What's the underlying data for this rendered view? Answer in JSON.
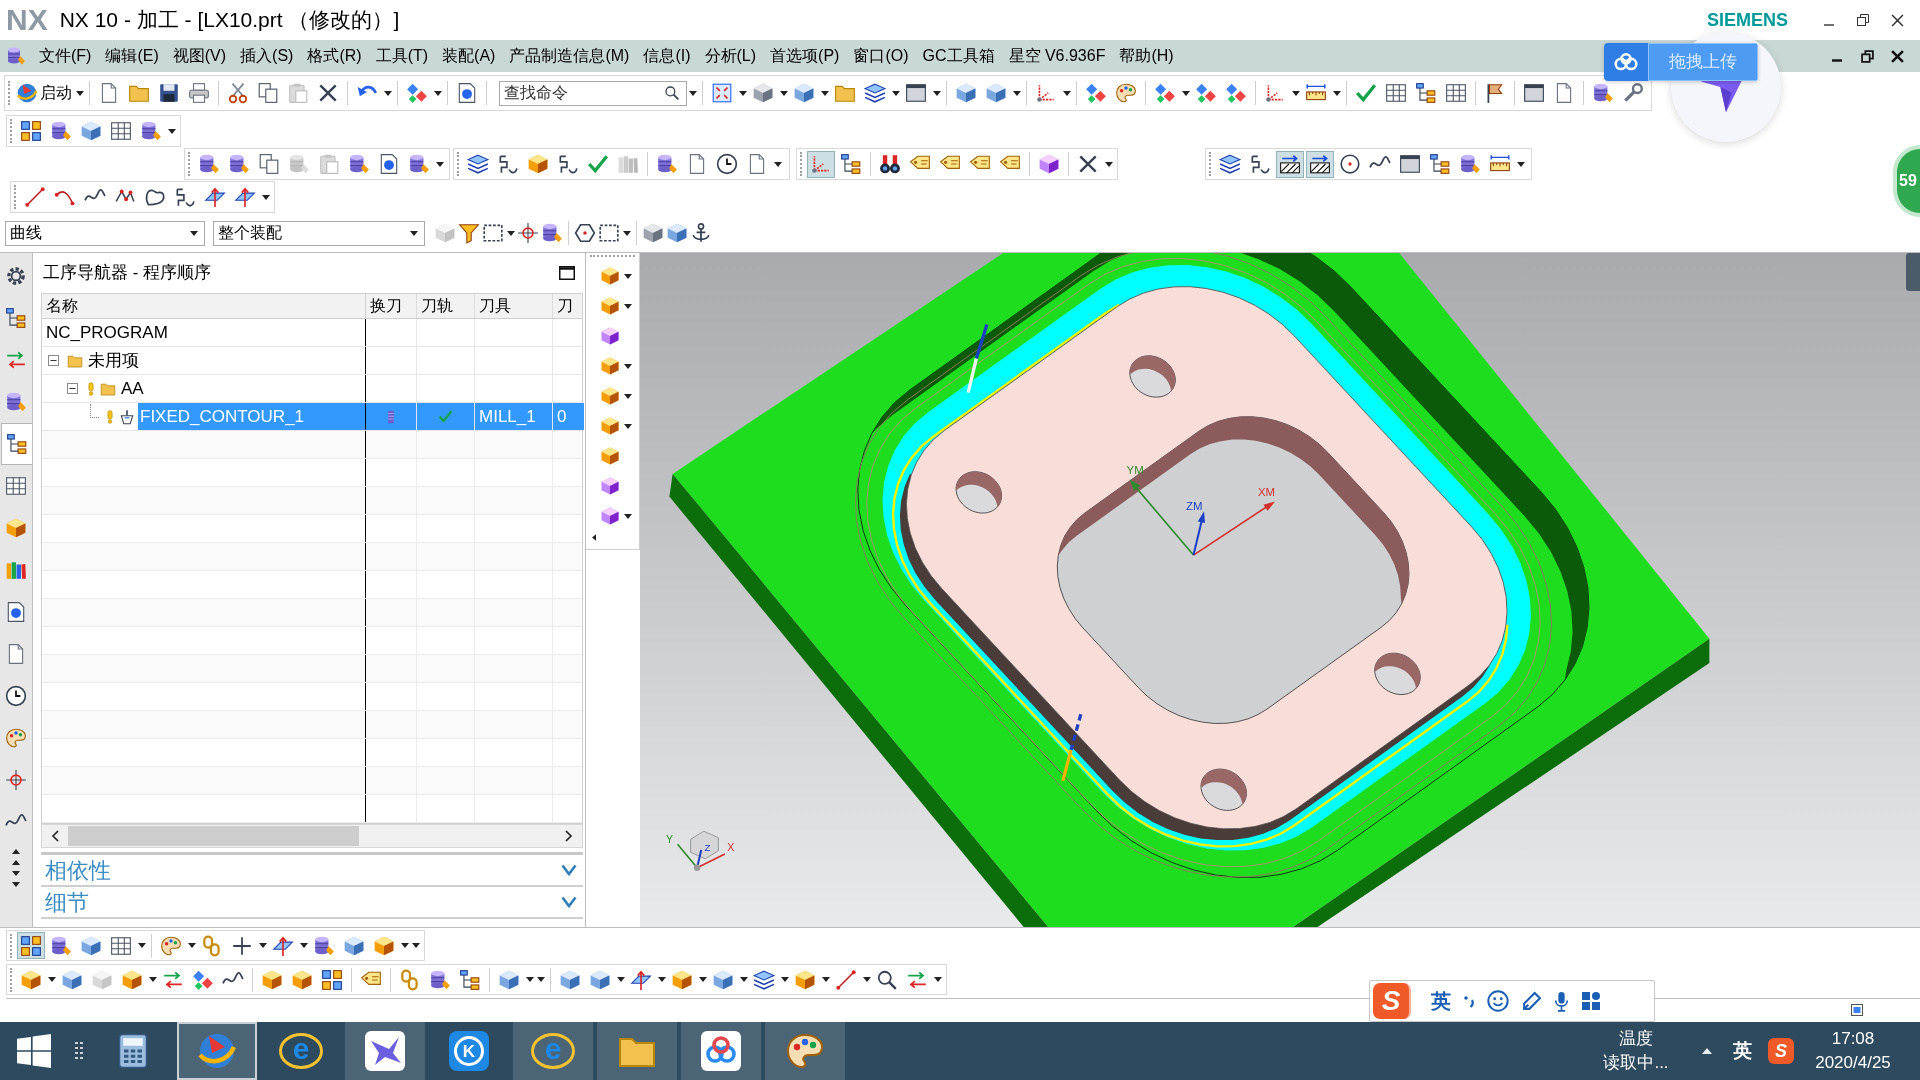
{
  "window": {
    "logo": "NX",
    "title": "NX 10 - 加工 - [LX10.prt （修改的）]",
    "brand": "SIEMENS"
  },
  "menu": [
    "文件(F)",
    "编辑(E)",
    "视图(V)",
    "插入(S)",
    "格式(R)",
    "工具(T)",
    "装配(A)",
    "产品制造信息(M)",
    "信息(I)",
    "分析(L)",
    "首选项(P)",
    "窗口(O)",
    "GC工具箱",
    "星空 V6.936F",
    "帮助(H)"
  ],
  "launch_button": {
    "label": "启动"
  },
  "command_finder": {
    "placeholder": "查找命令"
  },
  "toolbar_states": {
    "edit": [
      {
        "disabled": false
      },
      {
        "disabled": false
      },
      {
        "disabled": true
      },
      {
        "disabled": false
      }
    ],
    "operations": [
      {
        "disabled": false
      },
      {
        "disabled": false
      },
      {
        "disabled": false
      },
      {
        "disabled": true
      },
      {
        "disabled": true
      },
      {
        "disabled": false
      },
      {
        "disabled": false
      },
      {
        "disabled": false
      }
    ],
    "toolpath": [
      {
        "disabled": false
      },
      {
        "disabled": false
      },
      {
        "disabled": false
      },
      {
        "disabled": false
      },
      {
        "disabled": false
      },
      {
        "disabled": true
      },
      {
        "disabled": false
      },
      {
        "disabled": false
      },
      {
        "disabled": false
      },
      {
        "disabled": false
      }
    ],
    "display": [
      {
        "pressed": true
      },
      {
        "pressed": false
      },
      {
        "pressed": false
      },
      {
        "pressed": false
      },
      {
        "pressed": false
      },
      {
        "pressed": false
      },
      {
        "pressed": false
      },
      {
        "pressed": false
      }
    ],
    "analysis": [
      {
        "pressed": false
      },
      {
        "pressed": false
      },
      {
        "pressed": true
      },
      {
        "pressed": true
      },
      {
        "pressed": false
      },
      {
        "pressed": false
      },
      {
        "pressed": false
      },
      {
        "pressed": false
      },
      {
        "pressed": false
      },
      {
        "pressed": false
      }
    ],
    "selection": [
      {
        "disabled": true
      },
      {
        "disabled": false
      },
      {
        "disabled": false
      },
      {
        "disabled": false
      },
      {
        "disabled": false
      },
      {
        "disabled": false
      },
      {
        "disabled": false
      },
      {
        "disabled": false
      },
      {
        "disabled": false
      },
      {
        "disabled": false
      }
    ],
    "assembly": [
      {
        "pressed": true
      },
      {
        "pressed": false
      },
      {
        "pressed": false
      },
      {
        "pressed": false
      }
    ],
    "modeling": [
      {
        "disabled": false
      },
      {
        "disabled": false
      },
      {
        "disabled": true
      },
      {
        "disabled": false
      },
      {
        "disabled": false
      },
      {
        "disabled": false
      },
      {
        "disabled": false
      }
    ]
  },
  "selection_bar": {
    "filter": "曲线",
    "scope": "整个装配"
  },
  "resource_bar": [
    {
      "selected": false
    },
    {
      "selected": false
    },
    {
      "selected": false
    },
    {
      "selected": false
    },
    {
      "selected": true
    },
    {
      "selected": false
    },
    {
      "selected": false
    },
    {
      "selected": false
    },
    {
      "selected": false
    },
    {
      "selected": false
    },
    {
      "selected": false
    },
    {
      "selected": false
    },
    {
      "selected": false
    },
    {
      "selected": false
    }
  ],
  "navigator": {
    "title": "工序导航器 - 程序顺序",
    "columns": [
      "名称",
      "换刀",
      "刀轨",
      "刀具",
      "刀"
    ],
    "tree": [
      {
        "name": "NC_PROGRAM",
        "selected": false,
        "flagged": false,
        "tool_change": false,
        "path_generated": false,
        "children": [
          {
            "name": "未用项",
            "kind": "group",
            "expanded": true,
            "selected": false,
            "flagged": false,
            "tool_change": false,
            "path_generated": false,
            "children": [
              {
                "name": "AA",
                "kind": "group",
                "expanded": true,
                "selected": false,
                "flagged": true,
                "tool_change": false,
                "path_generated": false,
                "children": [
                  {
                    "name": "FIXED_CONTOUR_1",
                    "kind": "operation",
                    "selected": true,
                    "flagged": true,
                    "tool_change": true,
                    "path_generated": true,
                    "tool": "MILL_1",
                    "column_5": "0"
                  }
                ]
              }
            ]
          }
        ]
      }
    ]
  },
  "sections": [
    {
      "label": "相依性",
      "expanded": false
    },
    {
      "label": "细节",
      "expanded": false
    }
  ],
  "graphics": {
    "wcs_labels": {
      "x": "XM",
      "y": "YM",
      "z": "ZM"
    },
    "triad_labels": {
      "x": "X",
      "y": "Y",
      "z": "Z"
    }
  },
  "floating": {
    "upload_button": {
      "label": "拖拽上传"
    },
    "speed_ball": {
      "label": "59"
    }
  },
  "ime_bar": {
    "logo": "S",
    "mode": "英"
  },
  "taskbar": {
    "apps": [
      {
        "kind": "calculator",
        "running": false,
        "active": false
      },
      {
        "kind": "cad",
        "running": true,
        "active": true
      },
      {
        "kind": "browser",
        "glyph": "e",
        "running": false,
        "active": false
      },
      {
        "kind": "bird",
        "running": true,
        "active": false
      },
      {
        "kind": "k-app",
        "glyph": "K",
        "running": false,
        "active": false
      },
      {
        "kind": "browser",
        "glyph": "e",
        "running": true,
        "active": false
      },
      {
        "kind": "files",
        "running": true,
        "active": false
      },
      {
        "kind": "cloud",
        "running": true,
        "active": false
      },
      {
        "kind": "paint",
        "running": true,
        "active": false
      }
    ],
    "tray_widget": [
      "温度",
      "读取中..."
    ],
    "input_mode": "英",
    "ime_logo": "S",
    "time": "17:08",
    "date": "2020/4/25"
  }
}
